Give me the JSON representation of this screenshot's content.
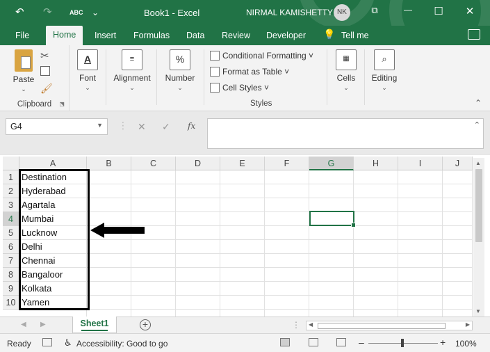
{
  "titlebar": {
    "title": "Book1  -  Excel",
    "user": "NIRMAL KAMISHETTY",
    "initials": "NK",
    "undo": "↶",
    "redo": "↷",
    "spell": "ABC",
    "customize": "⌄",
    "restore": "⧉",
    "minimize": "—",
    "maximize": "☐",
    "close": "✕"
  },
  "tabs": [
    "File",
    "Home",
    "Insert",
    "Formulas",
    "Data",
    "Review",
    "Developer",
    "Tell me"
  ],
  "ribbon": {
    "clipboard": {
      "paste": "Paste",
      "label": "Clipboard"
    },
    "font": "Font",
    "alignment": "Alignment",
    "number": "Number",
    "styles": {
      "conditional": "Conditional Formatting ˅",
      "table": "Format as Table ˅",
      "cell": "Cell Styles ˅",
      "label": "Styles"
    },
    "cells": "Cells",
    "editing": "Editing"
  },
  "formula_bar": {
    "name_box": "G4",
    "fx": "fx",
    "cancel": "✕",
    "enter": "✓",
    "value": ""
  },
  "grid": {
    "columns": [
      "A",
      "B",
      "C",
      "D",
      "E",
      "F",
      "G",
      "H",
      "I",
      "J"
    ],
    "selected_column": "G",
    "rows": [
      "1",
      "2",
      "3",
      "4",
      "5",
      "6",
      "7",
      "8",
      "9",
      "10"
    ],
    "selected_row": "4",
    "column_a": [
      "Destination",
      "Hyderabad",
      "Agartala",
      "Mumbai",
      "Lucknow",
      "Delhi",
      "Chennai",
      "Bangaloor",
      "Kolkata",
      "Yamen"
    ],
    "active_cell": "G4"
  },
  "sheets": {
    "active": "Sheet1",
    "add": "+"
  },
  "statusbar": {
    "ready": "Ready",
    "accessibility": "Accessibility: Good to go",
    "zoom": "100%",
    "zoom_out": "–",
    "zoom_in": "+"
  },
  "colors": {
    "accent": "#217346",
    "annotation": "#000000"
  }
}
